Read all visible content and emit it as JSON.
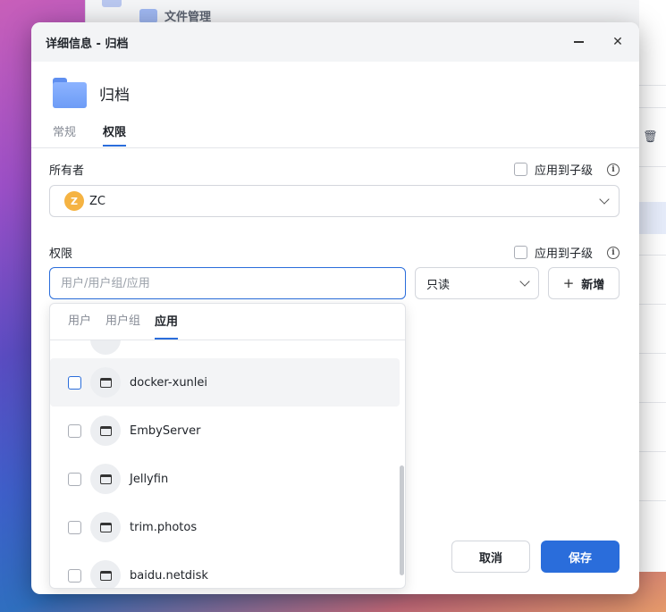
{
  "background": {
    "window_title": "文件管理"
  },
  "dialog": {
    "title": "详细信息 - 归档",
    "file_name": "归档",
    "tabs": [
      {
        "label": "常规"
      },
      {
        "label": "权限"
      }
    ]
  },
  "owner": {
    "label": "所有者",
    "apply_child": "应用到子级",
    "avatar_letter": "Z",
    "name": "ZC"
  },
  "permission": {
    "label": "权限",
    "apply_child": "应用到子级",
    "input_placeholder": "用户/用户组/应用",
    "level": "只读",
    "add_label": "新增"
  },
  "dropdown": {
    "tabs": [
      {
        "label": "用户"
      },
      {
        "label": "用户组"
      },
      {
        "label": "应用"
      }
    ],
    "items": [
      {
        "name": "docker-xunlei"
      },
      {
        "name": "EmbyServer"
      },
      {
        "name": "Jellyfin"
      },
      {
        "name": "trim.photos"
      },
      {
        "name": "baidu.netdisk"
      }
    ]
  },
  "footer": {
    "cancel_label": "取消",
    "save_label": "保存"
  },
  "colors": {
    "accent": "#2a6ddb",
    "avatar": "#f5b342"
  }
}
